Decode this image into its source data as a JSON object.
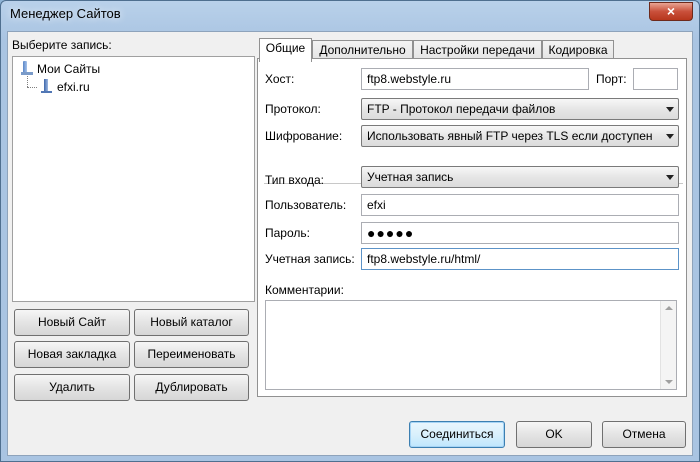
{
  "window": {
    "title": "Менеджер Сайтов",
    "close_glyph": "×"
  },
  "left": {
    "label": "Выберите запись:",
    "tree": [
      {
        "label": "Мои Сайты",
        "icon": "folder-icon"
      },
      {
        "label": "efxi.ru",
        "icon": "site-icon"
      }
    ],
    "buttons": {
      "new_site": "Новый Сайт",
      "new_folder": "Новый каталог",
      "new_bookmark": "Новая закладка",
      "rename": "Переименовать",
      "delete": "Удалить",
      "duplicate": "Дублировать"
    }
  },
  "tabs": [
    "Общие",
    "Дополнительно",
    "Настройки передачи",
    "Кодировка"
  ],
  "general": {
    "host_label": "Хост:",
    "host_value": "ftp8.webstyle.ru",
    "port_label": "Порт:",
    "port_value": "",
    "protocol_label": "Протокол:",
    "protocol_value": "FTP - Протокол передачи файлов",
    "encryption_label": "Шифрование:",
    "encryption_value": "Использовать явный FTP через TLS если доступен",
    "logon_label": "Тип входа:",
    "logon_value": "Учетная запись",
    "user_label": "Пользователь:",
    "user_value": "efxi",
    "password_label": "Пароль:",
    "password_value": "●●●●●",
    "account_label": "Учетная запись:",
    "account_value": "ftp8.webstyle.ru/html/",
    "comments_label": "Комментарии:"
  },
  "footer": {
    "connect": "Соединиться",
    "ok": "OK",
    "cancel": "Отмена"
  }
}
